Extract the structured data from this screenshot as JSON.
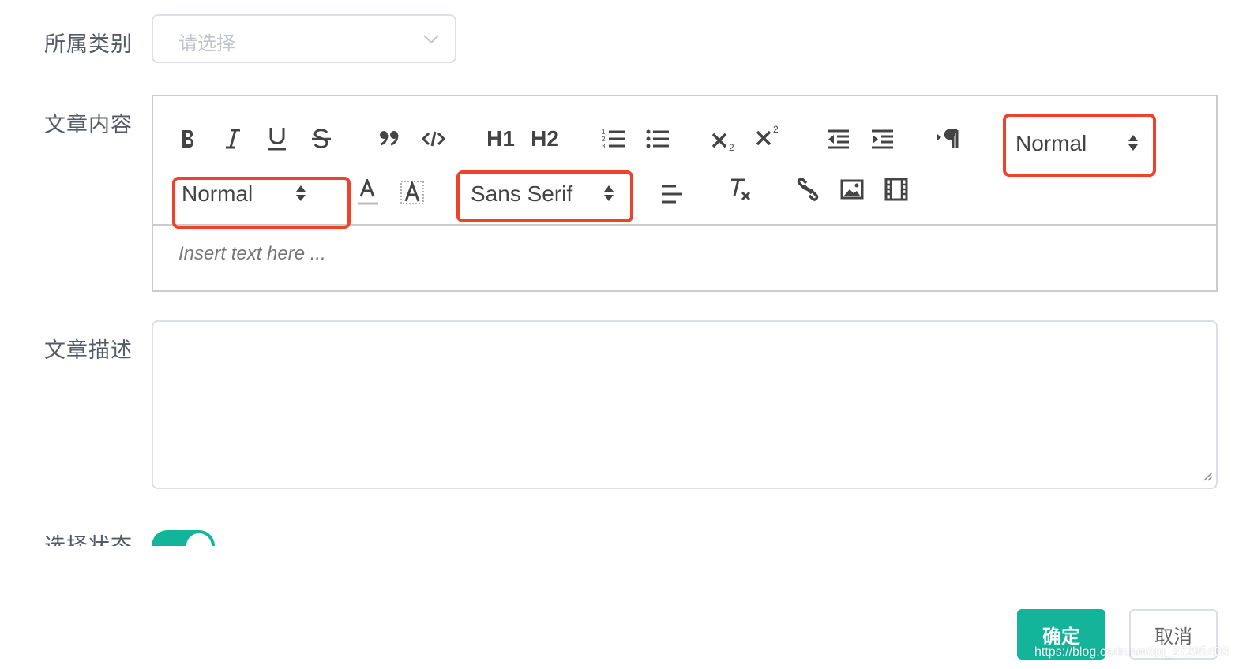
{
  "form": {
    "category_label": "所属类别",
    "category_placeholder": "请选择",
    "content_label": "文章内容",
    "description_label": "文章描述",
    "status_label": "选择状态",
    "status_on": true
  },
  "editor": {
    "toolbar": {
      "header_picker_value": "Normal",
      "size_picker_value": "Normal",
      "font_picker_value": "Sans Serif",
      "h1_label": "H1",
      "h2_label": "H2"
    },
    "placeholder": "Insert text here ..."
  },
  "buttons": {
    "confirm": "确定",
    "cancel": "取消"
  },
  "watermark": "https://blog.csdn.net/qq_27295403",
  "colors": {
    "accent": "#13b49a",
    "highlight": "#f0412b"
  }
}
